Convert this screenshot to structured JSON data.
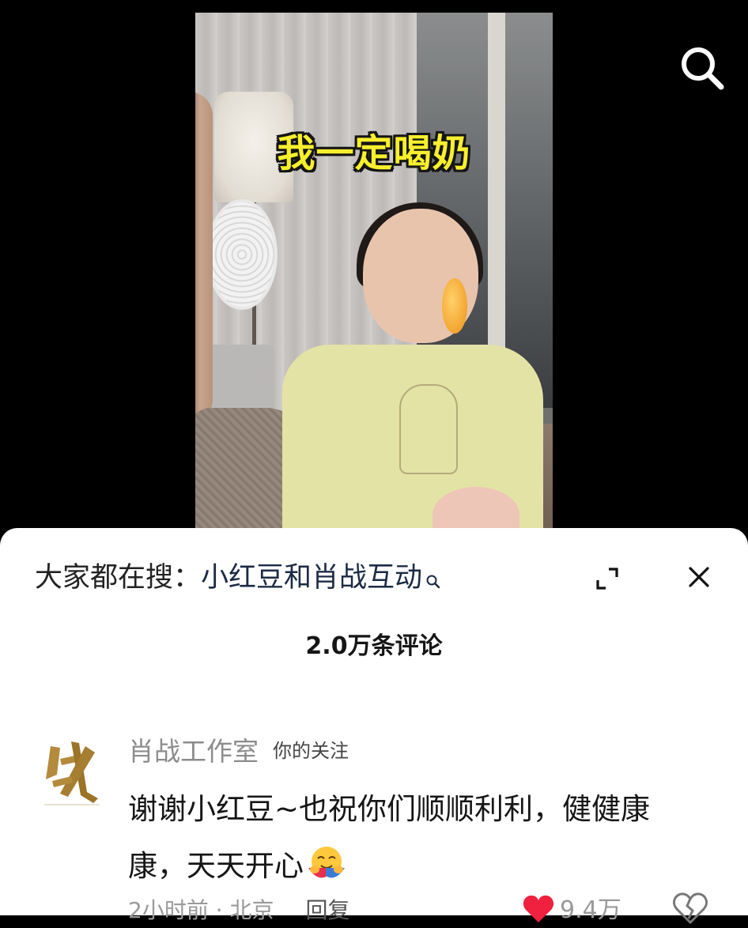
{
  "video": {
    "caption": "我一定喝奶"
  },
  "top_bar": {
    "search_icon": "search-icon"
  },
  "comment_sheet": {
    "hot_search": {
      "prefix": "大家都在搜：",
      "query": "小红豆和肖战互动"
    },
    "expand_icon": "expand-icon",
    "close_icon": "close-icon",
    "comment_count": "2.0万条评论",
    "comments": [
      {
        "author": "肖战工作室",
        "follow_tag": "你的关注",
        "text": "谢谢小红豆~也祝你们顺顺利利，健健康康，天天开心",
        "emoji": "hug-emoji",
        "time_location": "2小时前 · 北京",
        "reply_label": "回复",
        "like_count": "9.4万",
        "like_icon": "heart-icon",
        "dislike_icon": "broken-heart-icon"
      }
    ]
  },
  "colors": {
    "background": "#000000",
    "caption_fill": "#f7ef2d",
    "like_red": "#f0203f",
    "muted_gray": "#8c8c8c"
  }
}
